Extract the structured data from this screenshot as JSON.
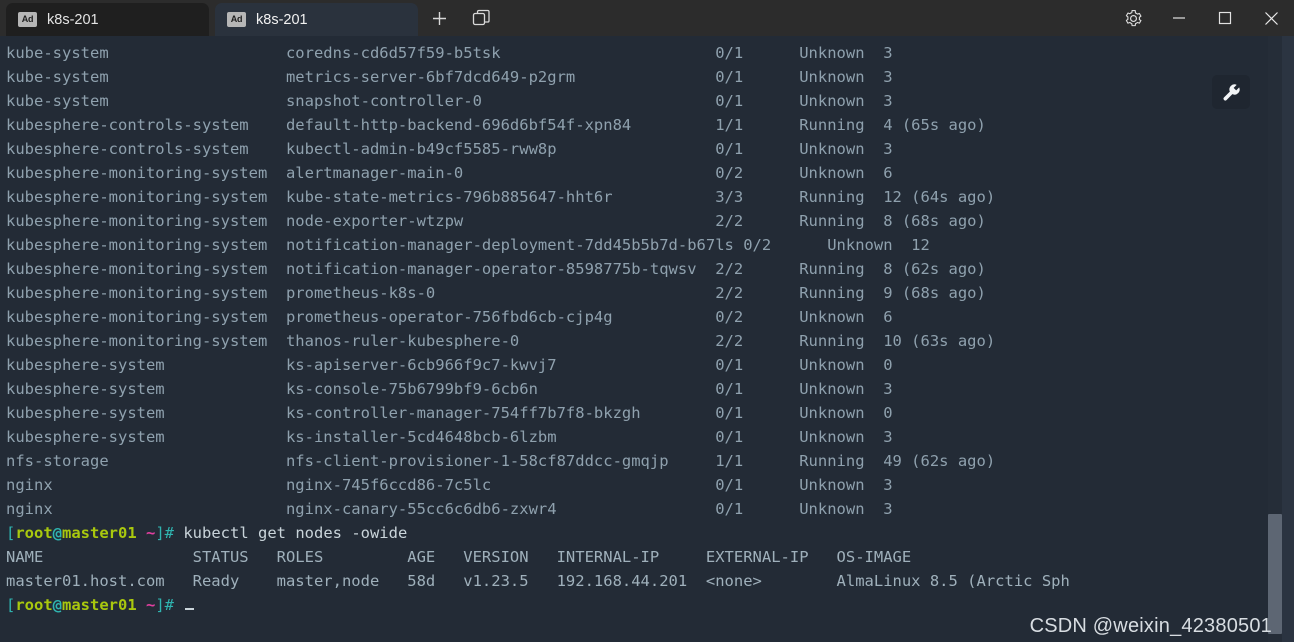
{
  "window": {
    "tabs": [
      {
        "label": "k8s-201",
        "icon_text": "Ad",
        "active": false
      },
      {
        "label": "k8s-201",
        "icon_text": "Ad",
        "active": true
      }
    ],
    "new_tab_label": "+",
    "panes_icon": "panes-icon",
    "settings_icon": "gear-icon",
    "minimize_label": "—",
    "maximize_label": "□",
    "close_label": "✕"
  },
  "overlay": {
    "wrench_icon": "wrench-icon"
  },
  "watermark": "CSDN @weixin_42380501",
  "colors": {
    "terminal_bg": "#232b36",
    "titlebar_bg": "#2c2c2c",
    "active_tab_bg": "#2a323d",
    "inactive_tab_bg": "#1f1f1f",
    "text": "#93a1ad",
    "prompt_user": "#a9c80e",
    "prompt_bracket": "#2fb4b0",
    "prompt_tilde": "#e23fa0",
    "scrollbar_thumb": "#5d6673"
  },
  "terminal": {
    "pods": [
      {
        "namespace": "kube-system",
        "name": "coredns-cd6d57f59-b5tsk",
        "ready": "0/1",
        "status": "Unknown",
        "restarts": "3"
      },
      {
        "namespace": "kube-system",
        "name": "metrics-server-6bf7dcd649-p2grm",
        "ready": "0/1",
        "status": "Unknown",
        "restarts": "3"
      },
      {
        "namespace": "kube-system",
        "name": "snapshot-controller-0",
        "ready": "0/1",
        "status": "Unknown",
        "restarts": "3"
      },
      {
        "namespace": "kubesphere-controls-system",
        "name": "default-http-backend-696d6bf54f-xpn84",
        "ready": "1/1",
        "status": "Running",
        "restarts": "4 (65s ago)"
      },
      {
        "namespace": "kubesphere-controls-system",
        "name": "kubectl-admin-b49cf5585-rww8p",
        "ready": "0/1",
        "status": "Unknown",
        "restarts": "3"
      },
      {
        "namespace": "kubesphere-monitoring-system",
        "name": "alertmanager-main-0",
        "ready": "0/2",
        "status": "Unknown",
        "restarts": "6"
      },
      {
        "namespace": "kubesphere-monitoring-system",
        "name": "kube-state-metrics-796b885647-hht6r",
        "ready": "3/3",
        "status": "Running",
        "restarts": "12 (64s ago)"
      },
      {
        "namespace": "kubesphere-monitoring-system",
        "name": "node-exporter-wtzpw",
        "ready": "2/2",
        "status": "Running",
        "restarts": "8 (68s ago)"
      },
      {
        "namespace": "kubesphere-monitoring-system",
        "name": "notification-manager-deployment-7dd45b5b7d-b67ls",
        "ready": "0/2",
        "status": "Unknown",
        "restarts": "12"
      },
      {
        "namespace": "kubesphere-monitoring-system",
        "name": "notification-manager-operator-8598775b-tqwsv",
        "ready": "2/2",
        "status": "Running",
        "restarts": "8 (62s ago)"
      },
      {
        "namespace": "kubesphere-monitoring-system",
        "name": "prometheus-k8s-0",
        "ready": "2/2",
        "status": "Running",
        "restarts": "9 (68s ago)"
      },
      {
        "namespace": "kubesphere-monitoring-system",
        "name": "prometheus-operator-756fbd6cb-cjp4g",
        "ready": "0/2",
        "status": "Unknown",
        "restarts": "6"
      },
      {
        "namespace": "kubesphere-monitoring-system",
        "name": "thanos-ruler-kubesphere-0",
        "ready": "2/2",
        "status": "Running",
        "restarts": "10 (63s ago)"
      },
      {
        "namespace": "kubesphere-system",
        "name": "ks-apiserver-6cb966f9c7-kwvj7",
        "ready": "0/1",
        "status": "Unknown",
        "restarts": "0"
      },
      {
        "namespace": "kubesphere-system",
        "name": "ks-console-75b6799bf9-6cb6n",
        "ready": "0/1",
        "status": "Unknown",
        "restarts": "3"
      },
      {
        "namespace": "kubesphere-system",
        "name": "ks-controller-manager-754ff7b7f8-bkzgh",
        "ready": "0/1",
        "status": "Unknown",
        "restarts": "0"
      },
      {
        "namespace": "kubesphere-system",
        "name": "ks-installer-5cd4648bcb-6lzbm",
        "ready": "0/1",
        "status": "Unknown",
        "restarts": "3"
      },
      {
        "namespace": "nfs-storage",
        "name": "nfs-client-provisioner-1-58cf87ddcc-gmqjp",
        "ready": "1/1",
        "status": "Running",
        "restarts": "49 (62s ago)"
      },
      {
        "namespace": "nginx",
        "name": "nginx-745f6ccd86-7c5lc",
        "ready": "0/1",
        "status": "Unknown",
        "restarts": "3"
      },
      {
        "namespace": "nginx",
        "name": "nginx-canary-55cc6c6db6-zxwr4",
        "ready": "0/1",
        "status": "Unknown",
        "restarts": "3"
      }
    ],
    "prompt": {
      "bracket_open": "[",
      "user": "root",
      "at": "@",
      "host": "master01",
      "tilde": " ~",
      "bracket_close": "]# "
    },
    "command": "kubectl get nodes -owide",
    "nodes_header": "NAME                STATUS   ROLES         AGE   VERSION   INTERNAL-IP     EXTERNAL-IP   OS-IMAGE",
    "nodes_row": "master01.host.com   Ready    master,node   58d   v1.23.5   192.168.44.201  <none>        AlmaLinux 8.5 (Arctic Sph",
    "cursor": "_"
  }
}
